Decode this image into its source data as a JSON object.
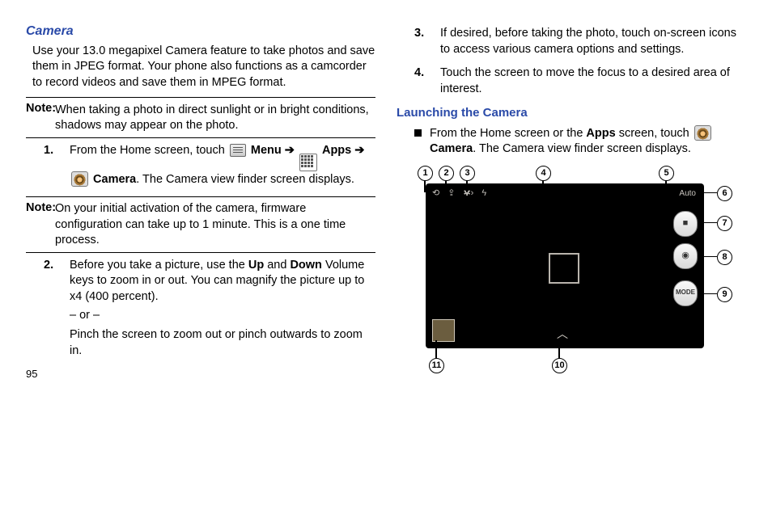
{
  "left": {
    "title": "Camera",
    "intro": "Use your 13.0 megapixel Camera feature to take photos and save them in JPEG format. Your phone also functions as a camcorder to record videos and save them in MPEG format.",
    "note1_label": "Note:",
    "note1_text": " When taking a photo in direct sunlight or in bright conditions, shadows may appear on the photo.",
    "step1_a": "From the Home screen, touch ",
    "step1_menu": " Menu ",
    "step1_arrow": "➔",
    "step1_apps": " Apps ",
    "step1_b": " ",
    "step1_camera": " Camera",
    "step1_c": ". The Camera view finder screen displays.",
    "note2_label": "Note:",
    "note2_text": " On your initial activation of the camera, firmware configuration can take up to 1 minute. This is a one time process.",
    "step2_a": "Before you take a picture, use the ",
    "step2_up": "Up",
    "step2_mid": " and ",
    "step2_down": "Down",
    "step2_b": " Volume keys to zoom in or out. You can magnify the picture up to x4 (400 percent).",
    "step2_or": "– or –",
    "step2_c": "Pinch the screen to zoom out or pinch outwards to zoom in.",
    "n1": "1.",
    "n2": "2.",
    "page": "95"
  },
  "right": {
    "n3": "3.",
    "n4": "4.",
    "step3": "If desired, before taking the photo, touch on-screen icons to access various camera options and settings.",
    "step4": "Touch the screen to move the focus to a desired area of interest.",
    "sub": "Launching the Camera",
    "bul_a": "From the Home screen or the ",
    "bul_apps": "Apps",
    "bul_b": " screen, touch ",
    "bul_cam": "Camera",
    "bul_c": ". The Camera view finder screen displays.",
    "callouts": {
      "c1": "1",
      "c2": "2",
      "c3": "3",
      "c4": "4",
      "c5": "5",
      "c6": "6",
      "c7": "7",
      "c8": "8",
      "c9": "9",
      "c10": "10",
      "c11": "11"
    },
    "auto_label": "Auto",
    "mode_label": "MODE"
  }
}
